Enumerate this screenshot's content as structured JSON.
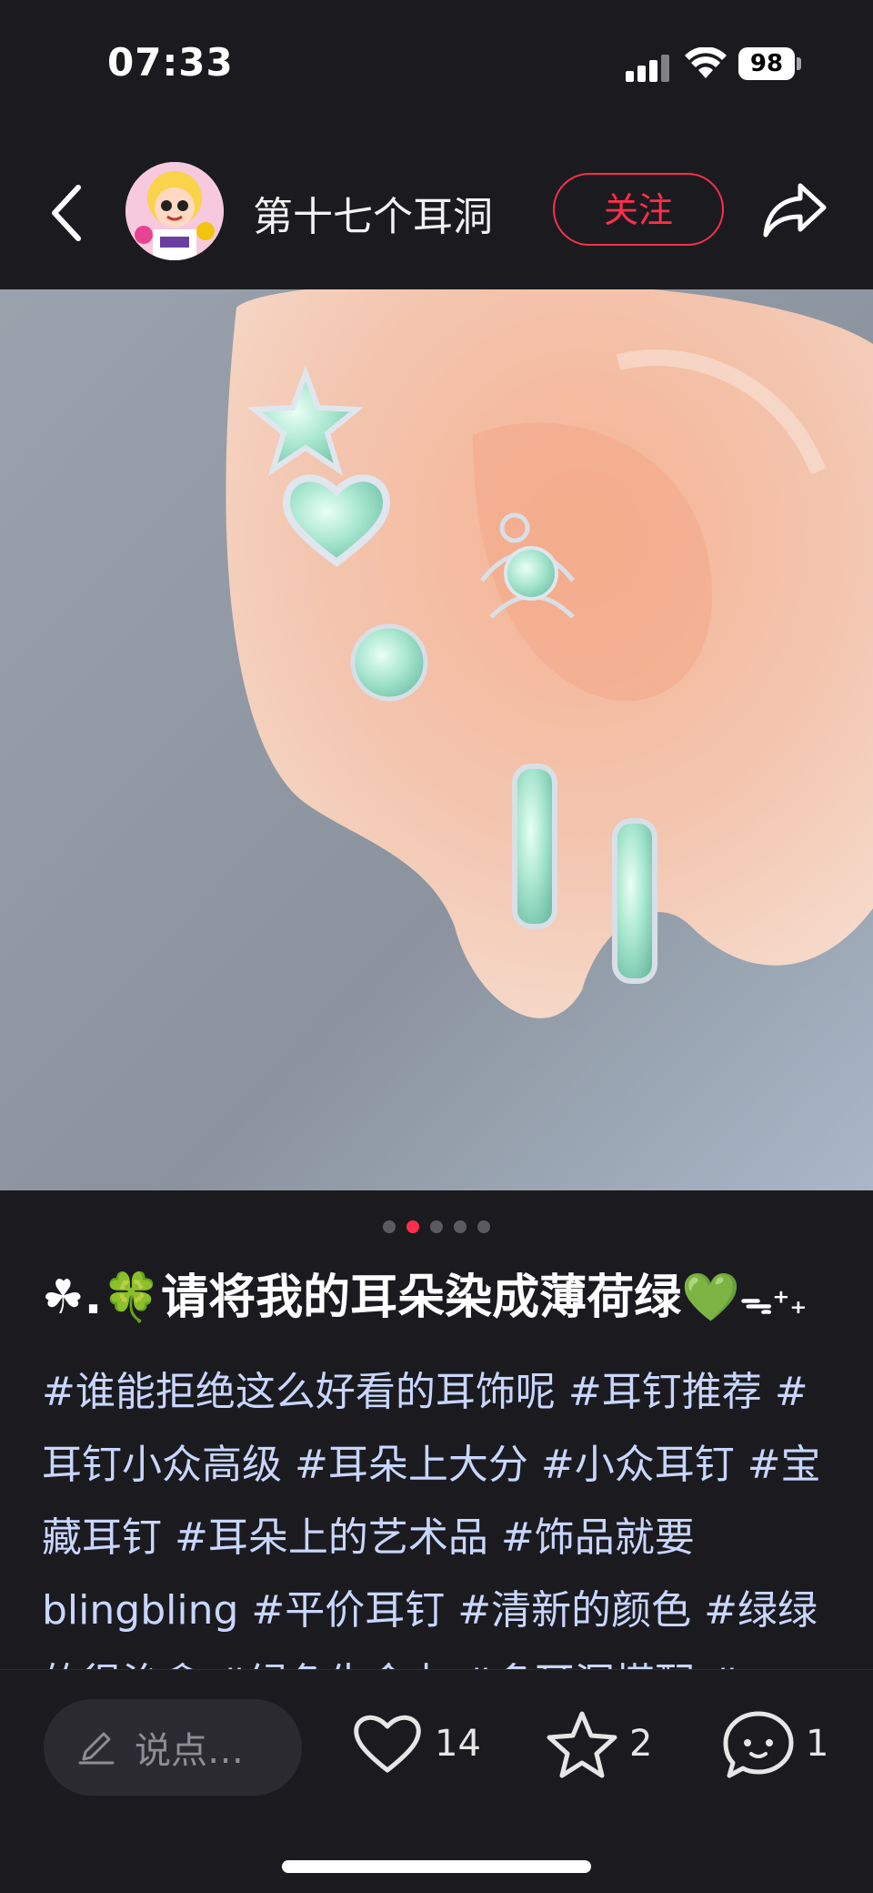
{
  "status": {
    "time": "07:33",
    "battery": "98"
  },
  "header": {
    "author_name": "第十七个耳洞",
    "follow_label": "关注"
  },
  "carousel": {
    "total": 5,
    "active_index": 1
  },
  "post": {
    "title": "☘︎.🍀请将我的耳朵染成薄荷绿💚₊˚₀·˚",
    "title_text": "☘.🍀请将我的耳朵染成薄荷绿💚",
    "title_tail": "ᯓ⁺₊",
    "tags": "#谁能拒绝这么好看的耳饰呢 #耳钉推荐 #耳钉小众高级 #耳朵上大分 #小众耳钉 #宝藏耳钉 #耳朵上的艺术品 #饰品就要 blingbling #平价耳钉 #清新的颜色 #绿绿的很治愈 #绿色生命力 #多耳洞搭配 #"
  },
  "bottom": {
    "comment_placeholder": "说点…",
    "likes": "14",
    "favorites": "2",
    "comments": "1"
  },
  "colors": {
    "accent": "#ff2e4d",
    "tag": "#c9d6ff",
    "bg": "#1b1b1f"
  }
}
